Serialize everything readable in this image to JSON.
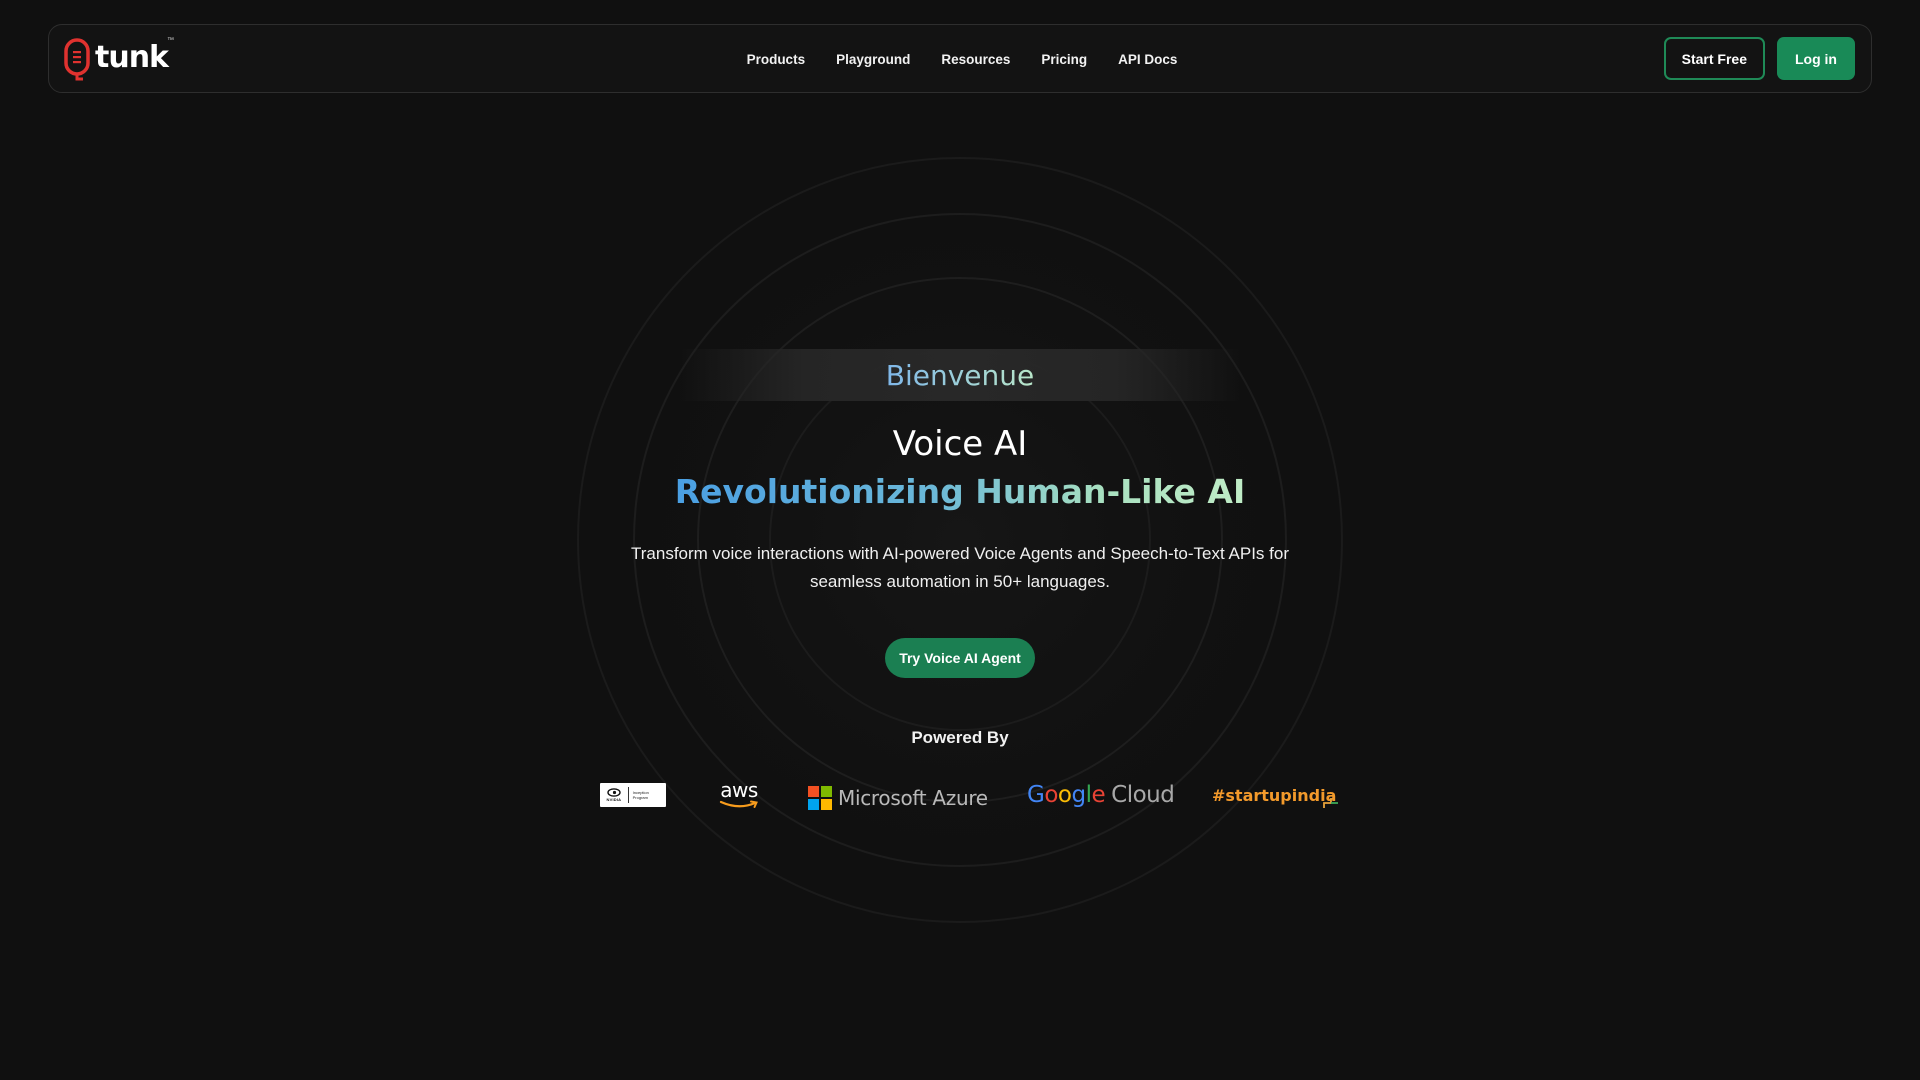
{
  "brand": {
    "name": "tunk",
    "tm": "™",
    "accent": "#1b8a57",
    "logo_mark_color": "#e0322f"
  },
  "nav": {
    "links": [
      "Products",
      "Playground",
      "Resources",
      "Pricing",
      "API Docs"
    ],
    "start_free": "Start Free",
    "login": "Log in"
  },
  "hero": {
    "welcome": "Bienvenue",
    "title": "Voice AI",
    "subtitle": "Revolutionizing Human-Like AI",
    "description": "Transform voice interactions with AI-powered Voice Agents and Speech-to-Text APIs for seamless automation in 50+ languages.",
    "cta": "Try Voice AI Agent",
    "powered_by": "Powered By"
  },
  "partners": {
    "nvidia": {
      "word": "NVIDIA",
      "program": "Inception Program"
    },
    "aws": "aws",
    "azure": "Microsoft Azure",
    "google": {
      "letters": [
        "G",
        "o",
        "o",
        "g",
        "l",
        "e"
      ],
      "colors": [
        "#4285F4",
        "#EA4335",
        "#FBBC05",
        "#4285F4",
        "#34A853",
        "#EA4335"
      ],
      "cloud": "Cloud"
    },
    "startup": "#startupindia"
  }
}
